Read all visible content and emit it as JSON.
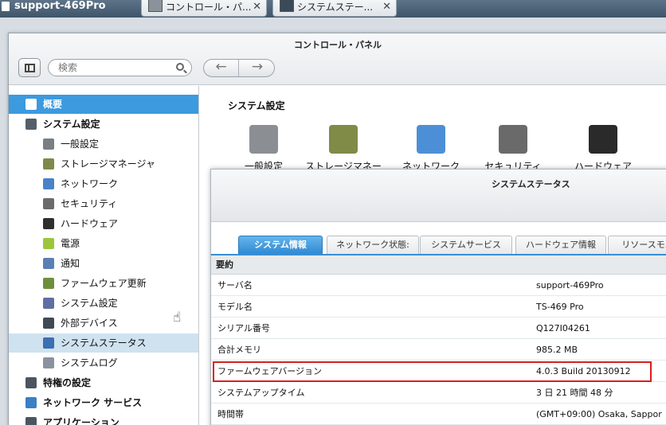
{
  "taskbar": {
    "host": "support-469Pro",
    "tabs": [
      {
        "label": "コントロール・パ..."
      },
      {
        "label": "システムステー..."
      }
    ]
  },
  "window": {
    "title": "コントロール・パネル",
    "search_placeholder": "検索",
    "back_glyph": "←",
    "forward_glyph": "→"
  },
  "sidebar": {
    "items": [
      {
        "label": "概要",
        "icon": "overview-icon",
        "level": "top",
        "color": "#ffffff"
      },
      {
        "label": "システム設定",
        "icon": "gear-icon",
        "level": "top",
        "color": "#555f69"
      },
      {
        "label": "一般設定",
        "icon": "general-settings-icon",
        "level": "sub",
        "color": "#7a7f84"
      },
      {
        "label": "ストレージマネージャ",
        "icon": "storage-icon",
        "level": "sub",
        "color": "#7e8a4a"
      },
      {
        "label": "ネットワーク",
        "icon": "network-icon",
        "level": "sub",
        "color": "#4a82c8"
      },
      {
        "label": "セキュリティ",
        "icon": "lock-icon",
        "level": "sub",
        "color": "#6b6b6b"
      },
      {
        "label": "ハードウェア",
        "icon": "hardware-icon",
        "level": "sub",
        "color": "#2f2f2f"
      },
      {
        "label": "電源",
        "icon": "power-icon",
        "level": "sub",
        "color": "#9bc63c"
      },
      {
        "label": "通知",
        "icon": "notification-icon",
        "level": "sub",
        "color": "#5b7fb5"
      },
      {
        "label": "ファームウェア更新",
        "icon": "firmware-update-icon",
        "level": "sub",
        "color": "#6d8f3a"
      },
      {
        "label": "システム設定",
        "icon": "backup-restore-icon",
        "level": "sub",
        "color": "#5f6fa3"
      },
      {
        "label": "外部デバイス",
        "icon": "external-device-icon",
        "level": "sub",
        "color": "#3f4a55"
      },
      {
        "label": "システムステータス",
        "icon": "system-status-icon",
        "level": "sub",
        "color": "#3a6fb1"
      },
      {
        "label": "システムログ",
        "icon": "system-log-icon",
        "level": "sub",
        "color": "#8a92a0"
      },
      {
        "label": "特権の設定",
        "icon": "user-icon",
        "level": "top",
        "color": "#4b5560"
      },
      {
        "label": "ネットワーク サービス",
        "icon": "network-services-icon",
        "level": "top",
        "color": "#3b7fc4"
      },
      {
        "label": "アプリケーション",
        "icon": "applications-icon",
        "level": "top",
        "color": "#4b5560"
      }
    ]
  },
  "content": {
    "section_title": "システム設定",
    "apps": [
      {
        "label": "一般設定",
        "icon": "general-settings-icon",
        "color": "#8b8f94"
      },
      {
        "label": "ストレージマネー",
        "icon": "storage-icon",
        "color": "#7f8b47"
      },
      {
        "label": "ネットワーク",
        "icon": "network-icon",
        "color": "#4d8fd6"
      },
      {
        "label": "セキュリティ",
        "icon": "lock-icon",
        "color": "#6a6a6a"
      },
      {
        "label": "ハードウェア",
        "icon": "hardware-icon",
        "color": "#2a2a2a"
      }
    ]
  },
  "status_window": {
    "title": "システムステータス",
    "tabs": [
      {
        "label": "システム情報",
        "selected": true
      },
      {
        "label": "ネットワーク状態:",
        "selected": false
      },
      {
        "label": "システムサービス",
        "selected": false
      },
      {
        "label": "ハードウェア情報",
        "selected": false
      },
      {
        "label": "リソースモニ",
        "selected": false
      }
    ],
    "group_label": "要約",
    "rows": [
      {
        "key": "サーバ名",
        "value": "support-469Pro"
      },
      {
        "key": "モデル名",
        "value": "TS-469 Pro"
      },
      {
        "key": "シリアル番号",
        "value": "Q127I04261"
      },
      {
        "key": "合計メモリ",
        "value": "985.2 MB"
      },
      {
        "key": "ファームウェアバージョン",
        "value": "4.0.3 Build 20130912"
      },
      {
        "key": "システムアップタイム",
        "value": "3 日 21 時間 48 分"
      },
      {
        "key": "時間帯",
        "value": "(GMT+09:00) Osaka, Sappor"
      }
    ],
    "highlight_color": "#d91e1e"
  }
}
